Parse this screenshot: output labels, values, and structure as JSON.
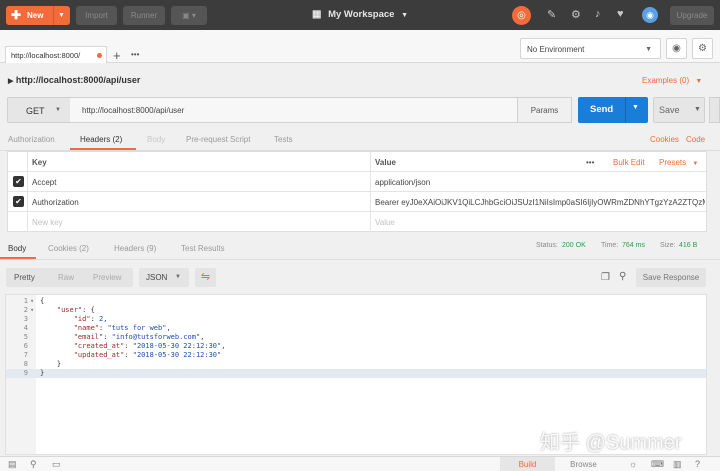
{
  "topbar": {
    "new_label": "New",
    "import_label": "Import",
    "runner_label": "Runner",
    "workspace_label": "My Workspace",
    "upgrade_label": "Upgrade"
  },
  "tabs": {
    "active_tab_label": "http://localhost:8000/",
    "environment_label": "No Environment"
  },
  "request": {
    "title": "http://localhost:8000/api/user",
    "examples_label": "Examples (0)",
    "method": "GET",
    "url": "http://localhost:8000/api/user",
    "params_label": "Params",
    "send_label": "Send",
    "save_label": "Save",
    "subtabs": [
      "Authorization",
      "Headers (2)",
      "Body",
      "Pre-request Script",
      "Tests"
    ],
    "cookies_label": "Cookies",
    "code_label": "Code"
  },
  "headers_table": {
    "key_header": "Key",
    "value_header": "Value",
    "more_label": "•••",
    "bulk_edit_label": "Bulk Edit",
    "presets_label": "Presets",
    "rows": [
      {
        "key": "Accept",
        "value": "application/json"
      },
      {
        "key": "Authorization",
        "value": "Bearer eyJ0eXAiOiJKV1QiLCJhbGciOiJSUzI1NiIsImp0aSI6IjIyOWRmZDNhYTgzYzA2ZTQzM..."
      }
    ],
    "new_key_placeholder": "New key",
    "new_value_placeholder": "Value"
  },
  "response": {
    "tabs": [
      "Body",
      "Cookies (2)",
      "Headers (9)",
      "Test Results"
    ],
    "status_label": "Status:",
    "status_value": "200 OK",
    "time_label": "Time:",
    "time_value": "764 ms",
    "size_label": "Size:",
    "size_value": "416 B",
    "formats": [
      "Pretty",
      "Raw",
      "Preview"
    ],
    "json_label": "JSON",
    "save_response_label": "Save Response",
    "code_lines": [
      {
        "n": "1",
        "fold": "▾",
        "parts": [
          [
            "pun",
            "{"
          ]
        ]
      },
      {
        "n": "2",
        "fold": "▾",
        "parts": [
          [
            "pun",
            "    "
          ],
          [
            "key",
            "\"user\""
          ],
          [
            "pun",
            ": {"
          ]
        ]
      },
      {
        "n": "3",
        "fold": "",
        "parts": [
          [
            "pun",
            "        "
          ],
          [
            "key",
            "\"id\""
          ],
          [
            "pun",
            ": "
          ],
          [
            "num",
            "2"
          ],
          [
            "pun",
            ","
          ]
        ]
      },
      {
        "n": "4",
        "fold": "",
        "parts": [
          [
            "pun",
            "        "
          ],
          [
            "key",
            "\"name\""
          ],
          [
            "pun",
            ": "
          ],
          [
            "str",
            "\"tuts for web\""
          ],
          [
            "pun",
            ","
          ]
        ]
      },
      {
        "n": "5",
        "fold": "",
        "parts": [
          [
            "pun",
            "        "
          ],
          [
            "key",
            "\"email\""
          ],
          [
            "pun",
            ": "
          ],
          [
            "str",
            "\"info@tutsforweb.com\""
          ],
          [
            "pun",
            ","
          ]
        ]
      },
      {
        "n": "6",
        "fold": "",
        "parts": [
          [
            "pun",
            "        "
          ],
          [
            "key",
            "\"created_at\""
          ],
          [
            "pun",
            ": "
          ],
          [
            "str",
            "\"2018-05-30 22:12:30\""
          ],
          [
            "pun",
            ","
          ]
        ]
      },
      {
        "n": "7",
        "fold": "",
        "parts": [
          [
            "pun",
            "        "
          ],
          [
            "key",
            "\"updated_at\""
          ],
          [
            "pun",
            ": "
          ],
          [
            "str",
            "\"2018-05-30 22:12:30\""
          ]
        ]
      },
      {
        "n": "8",
        "fold": "",
        "parts": [
          [
            "pun",
            "    }"
          ]
        ]
      },
      {
        "n": "9",
        "fold": "",
        "parts": [
          [
            "pun",
            "}"
          ]
        ]
      }
    ]
  },
  "bottombar": {
    "build_label": "Build",
    "browse_label": "Browse"
  },
  "watermark": "知乎 @Summer",
  "colors": {
    "accent": "#f26b3a",
    "send": "#1a7ed8",
    "status_ok": "#2e9e4a"
  }
}
